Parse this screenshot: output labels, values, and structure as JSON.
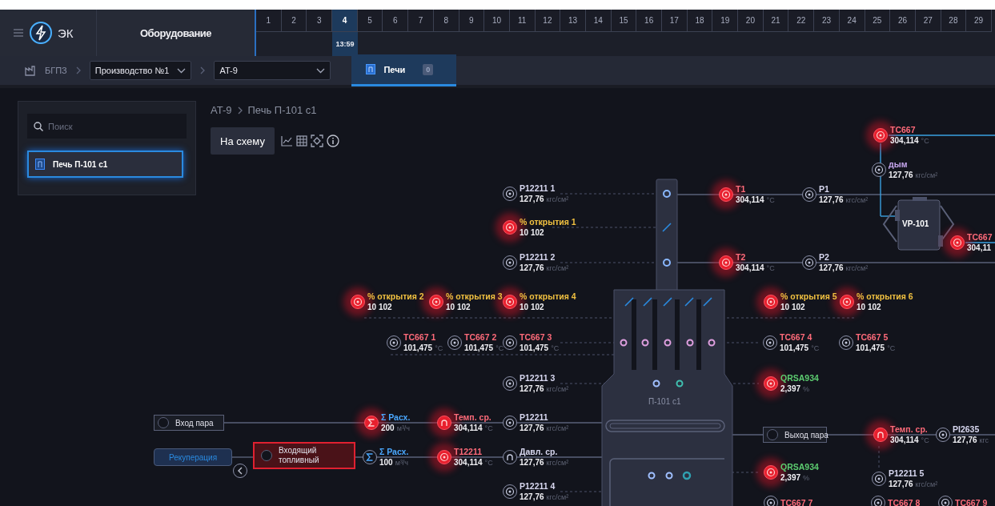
{
  "header": {
    "app_name": "ЭК",
    "section": "Оборудование",
    "days": [
      {
        "label": "1",
        "selected": false
      },
      {
        "label": "2",
        "selected": false
      },
      {
        "label": "3",
        "selected": false
      },
      {
        "label": "4",
        "selected": true,
        "time": "13:59"
      },
      {
        "label": "5",
        "selected": false
      },
      {
        "label": "6",
        "selected": false
      },
      {
        "label": "7",
        "selected": false
      },
      {
        "label": "8",
        "selected": false
      },
      {
        "label": "9",
        "selected": false
      },
      {
        "label": "10",
        "selected": false
      },
      {
        "label": "11",
        "selected": false
      },
      {
        "label": "12",
        "selected": false
      },
      {
        "label": "13",
        "selected": false
      },
      {
        "label": "14",
        "selected": false
      },
      {
        "label": "15",
        "selected": false
      },
      {
        "label": "16",
        "selected": false
      },
      {
        "label": "17",
        "selected": false
      },
      {
        "label": "18",
        "selected": false
      },
      {
        "label": "19",
        "selected": false
      },
      {
        "label": "20",
        "selected": false
      },
      {
        "label": "21",
        "selected": false
      },
      {
        "label": "22",
        "selected": false
      },
      {
        "label": "23",
        "selected": false
      },
      {
        "label": "24",
        "selected": false
      },
      {
        "label": "25",
        "selected": false
      },
      {
        "label": "26",
        "selected": false
      },
      {
        "label": "27",
        "selected": false
      },
      {
        "label": "28",
        "selected": false
      },
      {
        "label": "29",
        "selected": false
      }
    ]
  },
  "nav": {
    "root": "БГПЗ",
    "dropdowns": [
      {
        "value": "Производство №1"
      },
      {
        "value": "AT-9"
      }
    ],
    "tabs": [
      {
        "label": "Печи",
        "count": "0",
        "selected": true
      }
    ]
  },
  "sidebar": {
    "search": {
      "placeholder": "Поиск"
    },
    "items": [
      {
        "label": "Печь П-101 c1",
        "selected": true
      }
    ]
  },
  "breadcrumb": [
    "AT-9",
    "Печь П-101 c1"
  ],
  "toolbar": {
    "button": "На схему"
  },
  "diagram": {
    "furnace_label": "П-101 c1",
    "blocks": [
      {
        "kind": "port",
        "label": "Вход пара",
        "alarm": false
      },
      {
        "kind": "exchanger",
        "label": "Рекуперация"
      },
      {
        "kind": "port",
        "label": "Входящий топливный",
        "alarm": true
      },
      {
        "kind": "port",
        "label": "Выход пара",
        "alarm": false
      },
      {
        "kind": "unit",
        "label": "VP-101"
      }
    ],
    "sensors": [
      {
        "kind": "point",
        "name": "TC667",
        "value": "304,114",
        "unit": "°C",
        "color": "#ff6b7a",
        "alarm": true
      },
      {
        "kind": "point",
        "name": "дым",
        "value": "127,76",
        "unit": "кгс/см²",
        "color": "#c8a8f0",
        "alarm": false
      },
      {
        "kind": "point",
        "name": "P12211 1",
        "value": "127,76",
        "unit": "кгс/см²",
        "color": "#d8d8f0",
        "alarm": false
      },
      {
        "kind": "point",
        "name": "T1",
        "value": "304,114",
        "unit": "°C",
        "color": "#ff6b7a",
        "alarm": true
      },
      {
        "kind": "point",
        "name": "P1",
        "value": "127,76",
        "unit": "кгс/см²",
        "color": "#d8d8f0",
        "alarm": false
      },
      {
        "kind": "point",
        "name": "% открытия 1",
        "value": "10 102",
        "color": "#f0c040",
        "alarm": true
      },
      {
        "kind": "point",
        "name": "TC667",
        "value": "304,11",
        "color": "#ff6b7a",
        "alarm": true
      },
      {
        "kind": "point",
        "name": "P12211 2",
        "value": "127,76",
        "unit": "кгс/см²",
        "color": "#d8d8f0",
        "alarm": false
      },
      {
        "kind": "point",
        "name": "T2",
        "value": "304,114",
        "unit": "°C",
        "color": "#ff6b7a",
        "alarm": true
      },
      {
        "kind": "point",
        "name": "P2",
        "value": "127,76",
        "unit": "кгс/см²",
        "color": "#d8d8f0",
        "alarm": false
      },
      {
        "kind": "point",
        "name": "% открытия 2",
        "value": "10 102",
        "color": "#f0c040",
        "alarm": true
      },
      {
        "kind": "point",
        "name": "% открытия 3",
        "value": "10 102",
        "color": "#f0c040",
        "alarm": true
      },
      {
        "kind": "point",
        "name": "% открытия 4",
        "value": "10 102",
        "color": "#f0c040",
        "alarm": true
      },
      {
        "kind": "point",
        "name": "% открытия 5",
        "value": "10 102",
        "color": "#f0c040",
        "alarm": true
      },
      {
        "kind": "point",
        "name": "% открытия 6",
        "value": "10 102",
        "color": "#f0c040",
        "alarm": true
      },
      {
        "kind": "point",
        "name": "TC667 1",
        "value": "101,475",
        "unit": "°C",
        "color": "#ff6b7a",
        "alarm": false
      },
      {
        "kind": "point",
        "name": "TC667 2",
        "value": "101,475",
        "unit": "°C",
        "color": "#ff6b7a",
        "alarm": false
      },
      {
        "kind": "point",
        "name": "TC667 3",
        "value": "101,475",
        "unit": "°C",
        "color": "#ff6b7a",
        "alarm": false
      },
      {
        "kind": "point",
        "name": "TC667 4",
        "value": "101,475",
        "unit": "°C",
        "color": "#ff6b7a",
        "alarm": false
      },
      {
        "kind": "point",
        "name": "TC667 5",
        "value": "101,475",
        "unit": "°C",
        "color": "#ff6b7a",
        "alarm": false
      },
      {
        "kind": "point",
        "name": "P12211 3",
        "value": "127,76",
        "unit": "кгс/см²",
        "color": "#d8d8f0",
        "alarm": false
      },
      {
        "kind": "point",
        "name": "QRSA934",
        "value": "2,397",
        "unit": "%",
        "color": "#5ccc70",
        "alarm": true
      },
      {
        "kind": "sum",
        "name": "Σ Расх.",
        "value": "200",
        "unit": "м³/ч",
        "color": "#4aa8ff",
        "alarm": true
      },
      {
        "kind": "average",
        "name": "Темп. ср.",
        "value": "304,114",
        "unit": "°C",
        "color": "#ff6b7a",
        "alarm": true
      },
      {
        "kind": "point",
        "name": "P12211",
        "value": "127,76",
        "unit": "кгс/см²",
        "color": "#d8d8f0",
        "alarm": false
      },
      {
        "kind": "average",
        "name": "Темп. ср.",
        "value": "304,114",
        "unit": "°C",
        "color": "#ff6b7a",
        "alarm": true
      },
      {
        "kind": "point",
        "name": "PI2635",
        "value": "127,76",
        "unit": "кгс",
        "color": "#d8d8f0",
        "alarm": false
      },
      {
        "kind": "sum",
        "name": "Σ Расх.",
        "value": "100",
        "unit": "м³/ч",
        "color": "#4aa8ff",
        "alarm": false
      },
      {
        "kind": "point",
        "name": "T12211",
        "value": "304,114",
        "unit": "°C",
        "color": "#ff6b7a",
        "alarm": true
      },
      {
        "kind": "average",
        "name": "Давл. ср.",
        "value": "127,76",
        "unit": "кгс/см²",
        "color": "#d8d8f0",
        "alarm": false
      },
      {
        "kind": "point",
        "name": "QRSA934",
        "value": "2,397",
        "unit": "%",
        "color": "#5ccc70",
        "alarm": true
      },
      {
        "kind": "point",
        "name": "P12211 5",
        "value": "127,76",
        "unit": "кгс/см²",
        "color": "#d8d8f0",
        "alarm": false
      },
      {
        "kind": "point",
        "name": "P12211 4",
        "value": "127,76",
        "unit": "кгс/см²",
        "color": "#d8d8f0",
        "alarm": false
      },
      {
        "kind": "point",
        "name": "TC667 7",
        "color": "#ff6b7a",
        "alarm": false
      },
      {
        "kind": "point",
        "name": "TC667 8",
        "color": "#ff6b7a",
        "alarm": false
      },
      {
        "kind": "point",
        "name": "TC667 9",
        "color": "#ff6b7a",
        "alarm": false
      }
    ]
  }
}
